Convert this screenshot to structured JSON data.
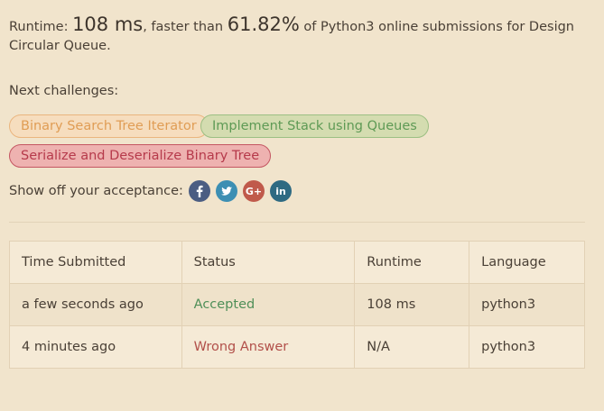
{
  "summary": {
    "runtime_prefix": "Runtime: ",
    "runtime_value": "108 ms",
    "faster_text": ", faster than ",
    "percent_value": "61.82%",
    "rest_text": " of Python3 online submissions for Design Circular Queue."
  },
  "next": {
    "label": "Next challenges:",
    "challenges": [
      {
        "label": "Binary Search Tree Iterator",
        "difficulty_color": "#e09d55"
      },
      {
        "label": "Implement Stack using Queues",
        "difficulty_color": "#5e9a55"
      },
      {
        "label": "Serialize and Deserialize Binary Tree",
        "difficulty_color": "#b63a4b"
      }
    ]
  },
  "share": {
    "label": "Show off your acceptance:",
    "icons": [
      {
        "name": "facebook-icon",
        "glyph": "f",
        "color": "#4b5d82"
      },
      {
        "name": "twitter-icon",
        "glyph": "t",
        "color": "#3d8fb3"
      },
      {
        "name": "google-plus-icon",
        "glyph": "G+",
        "color": "#c05a4b"
      },
      {
        "name": "linkedin-icon",
        "glyph": "in",
        "color": "#2e6a82"
      }
    ]
  },
  "table": {
    "headers": [
      "Time Submitted",
      "Status",
      "Runtime",
      "Language"
    ],
    "rows": [
      {
        "time": "a few seconds ago",
        "status": "Accepted",
        "runtime": "108 ms",
        "language": "python3"
      },
      {
        "time": "4 minutes ago",
        "status": "Wrong Answer",
        "runtime": "N/A",
        "language": "python3"
      }
    ]
  },
  "colors": {
    "background": "#f1e4cc",
    "accepted": "#4f8f58",
    "wrong_answer": "#b2504a"
  }
}
